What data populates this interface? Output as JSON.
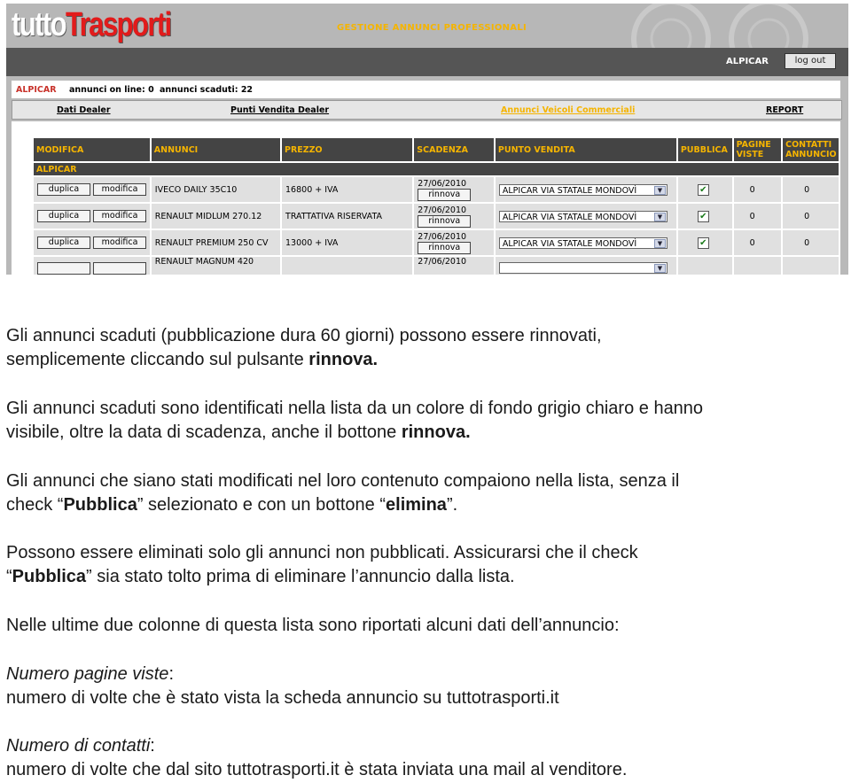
{
  "header": {
    "logo_part1": "tutto",
    "logo_part2": "Trasporti",
    "section_title": "GESTIONE ANNUNCI PROFESSIONALI",
    "user": "ALPICAR",
    "logout_label": "log out"
  },
  "infobar": {
    "dealer": "ALPICAR",
    "online": "annunci on line: 0",
    "expired": "annunci scaduti: 22"
  },
  "nav": {
    "items": [
      "Dati Dealer",
      "Punti Vendita Dealer",
      "Annunci Veicoli Commerciali",
      "REPORT"
    ]
  },
  "table": {
    "headers": [
      "MODIFICA",
      "ANNUNCI",
      "PREZZO",
      "SCADENZA",
      "PUNTO VENDITA",
      "PUBBLICA",
      "PAGINE VISTE",
      "CONTATTI ANNUNCIO"
    ],
    "group": "ALPICAR",
    "duplica_label": "duplica",
    "modifica_label": "modifica",
    "rinnova_label": "rinnova",
    "rows": [
      {
        "annuncio": "IVECO DAILY 35C10",
        "prezzo": "16800 + IVA",
        "scadenza": "27/06/2010",
        "punto_vendita": "ALPICAR VIA STATALE MONDOVÌ",
        "pubblica": true,
        "viste": "0",
        "contatti": "0"
      },
      {
        "annuncio": "RENAULT MIDLUM 270.12",
        "prezzo": "TRATTATIVA RISERVATA",
        "scadenza": "27/06/2010",
        "punto_vendita": "ALPICAR VIA STATALE MONDOVÌ",
        "pubblica": true,
        "viste": "0",
        "contatti": "0"
      },
      {
        "annuncio": "RENAULT PREMIUM 250 CV",
        "prezzo": "13000 + IVA",
        "scadenza": "27/06/2010",
        "punto_vendita": "ALPICAR VIA STATALE MONDOVÌ",
        "pubblica": true,
        "viste": "0",
        "contatti": "0"
      },
      {
        "annuncio": "RENAULT MAGNUM 420",
        "prezzo": "",
        "scadenza": "27/06/2010",
        "punto_vendita": "",
        "pubblica": false,
        "viste": "",
        "contatti": ""
      }
    ]
  },
  "doc": {
    "p1a": "Gli annunci scaduti (pubblicazione dura 60 giorni) possono essere rinnovati,",
    "p1b": "semplicemente cliccando sul pulsante ",
    "p1b_bold": "rinnova.",
    "p2a": "Gli annunci scaduti sono identificati nella lista da un colore di fondo grigio chiaro e hanno",
    "p2b": "visibile, oltre la data di scadenza, anche il bottone ",
    "p2b_bold": "rinnova.",
    "p3a": "Gli annunci che siano stati modificati nel loro contenuto compaiono nella lista, senza il",
    "p3b_pre": "check “",
    "p3b_bold1": "Pubblica",
    "p3b_mid": "” selezionato e con un bottone “",
    "p3b_bold2": "elimina",
    "p3b_post": "”.",
    "p4a": "Possono essere eliminati solo gli annunci non pubblicati. Assicurarsi che il check",
    "p4b_pre": "“",
    "p4b_bold": "Pubblica",
    "p4b_post": "” sia stato tolto prima di eliminare l’annuncio dalla lista.",
    "p5": "Nelle ultime due colonne di questa lista sono riportati alcuni dati dell’annuncio:",
    "p6_label": "Numero pagine viste",
    "p6_colon": ":",
    "p6_text": "numero di volte che è stato vista la scheda annuncio su tuttotrasporti.it",
    "p7_label": "Numero di contatti",
    "p7_colon": ":",
    "p7_text": "numero di volte che dal sito tuttotrasporti.it è stata inviata una mail al venditore."
  }
}
